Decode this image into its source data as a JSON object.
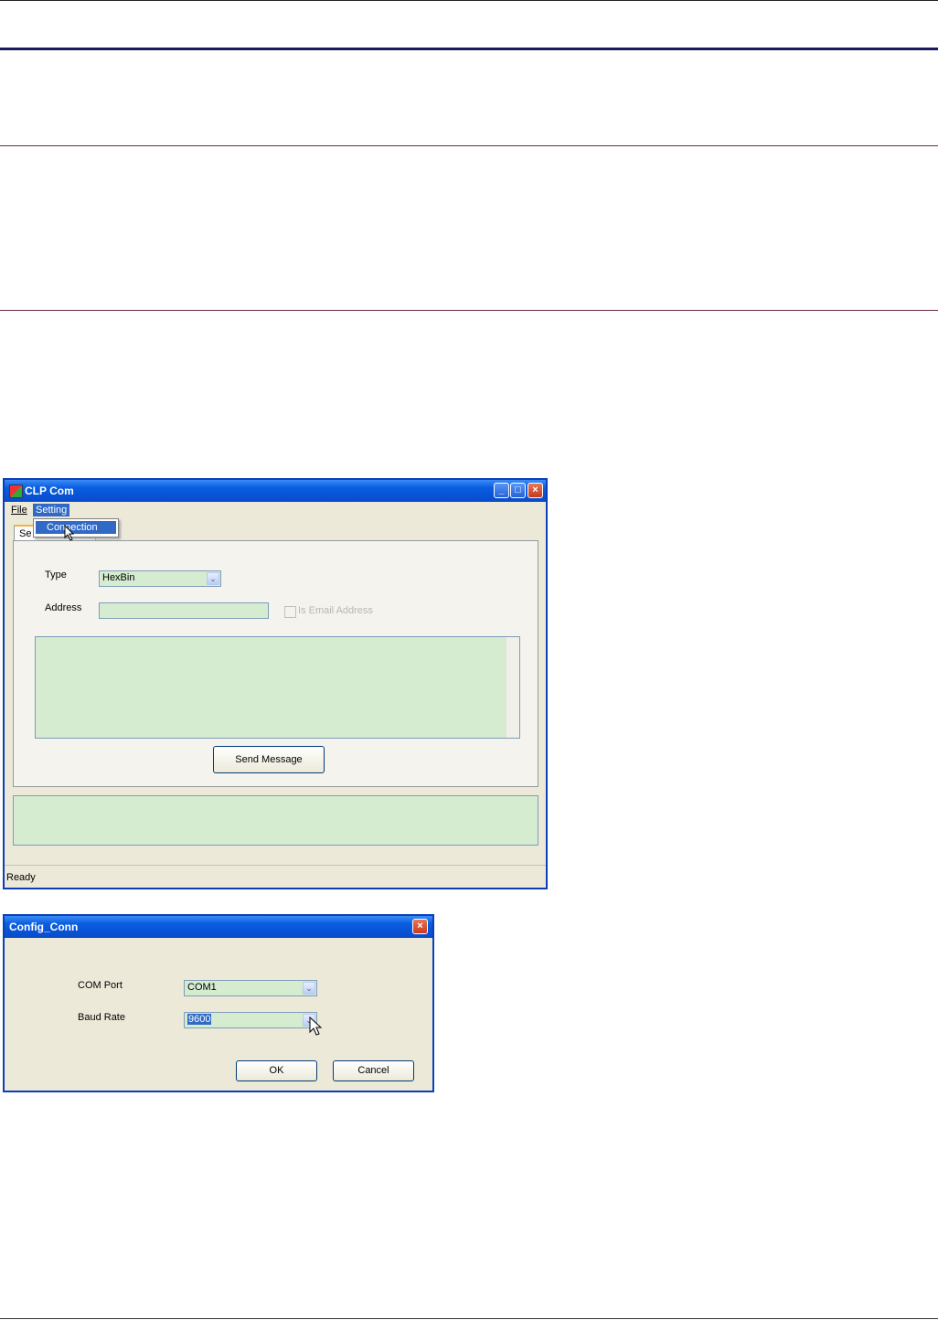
{
  "main_window": {
    "title": "CLP Com",
    "menu": {
      "file": "File",
      "setting": "Setting"
    },
    "dropdown_item": "Connection",
    "tab_label": "Se",
    "type_label": "Type",
    "type_value": "HexBin",
    "address_label": "Address",
    "address_value": "",
    "email_checkbox_label": "Is Email Address",
    "message_text": "",
    "send_button": "Send Message",
    "status": "Ready",
    "caption_minimize": "_",
    "caption_maximize": "□",
    "caption_close": "×"
  },
  "config_dialog": {
    "title": "Config_Conn",
    "com_port_label": "COM Port",
    "com_port_value": "COM1",
    "baud_rate_label": "Baud Rate",
    "baud_rate_value": "9600",
    "ok_button": "OK",
    "cancel_button": "Cancel",
    "caption_close": "×"
  },
  "icons": {
    "combo_arrow": "chevron-down-icon",
    "cursor": "mouse-pointer-icon"
  }
}
